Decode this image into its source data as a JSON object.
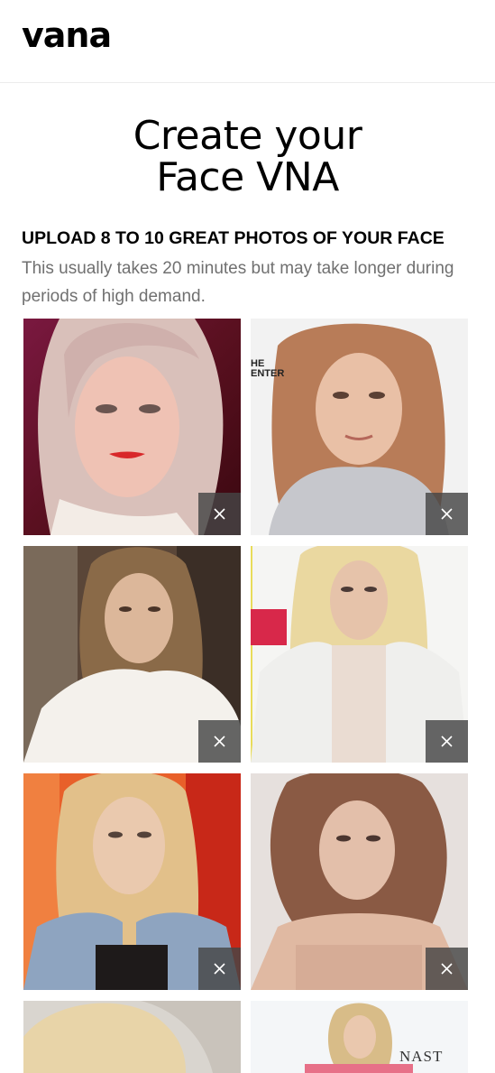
{
  "app": {
    "logo_text": "vana"
  },
  "page": {
    "title_line1": "Create your",
    "title_line2": "Face VNA",
    "upload_heading": "UPLOAD 8 TO 10 GREAT PHOTOS OF YOUR FACE",
    "upload_subtext": "This usually takes 20 minutes but may take longer during periods of high demand."
  },
  "photos": [
    {
      "alt": "photo 1",
      "remove_icon": "close-icon"
    },
    {
      "alt": "photo 2",
      "remove_icon": "close-icon",
      "overlay_text": "HE\nENTER"
    },
    {
      "alt": "photo 3",
      "remove_icon": "close-icon"
    },
    {
      "alt": "photo 4",
      "remove_icon": "close-icon"
    },
    {
      "alt": "photo 5",
      "remove_icon": "close-icon"
    },
    {
      "alt": "photo 6",
      "remove_icon": "close-icon"
    },
    {
      "alt": "photo 7"
    },
    {
      "alt": "photo 8",
      "overlay_text": "NAST"
    }
  ],
  "colors": {
    "remove_button_bg": "#464646",
    "divider": "#ececec",
    "subtext": "#707070"
  }
}
